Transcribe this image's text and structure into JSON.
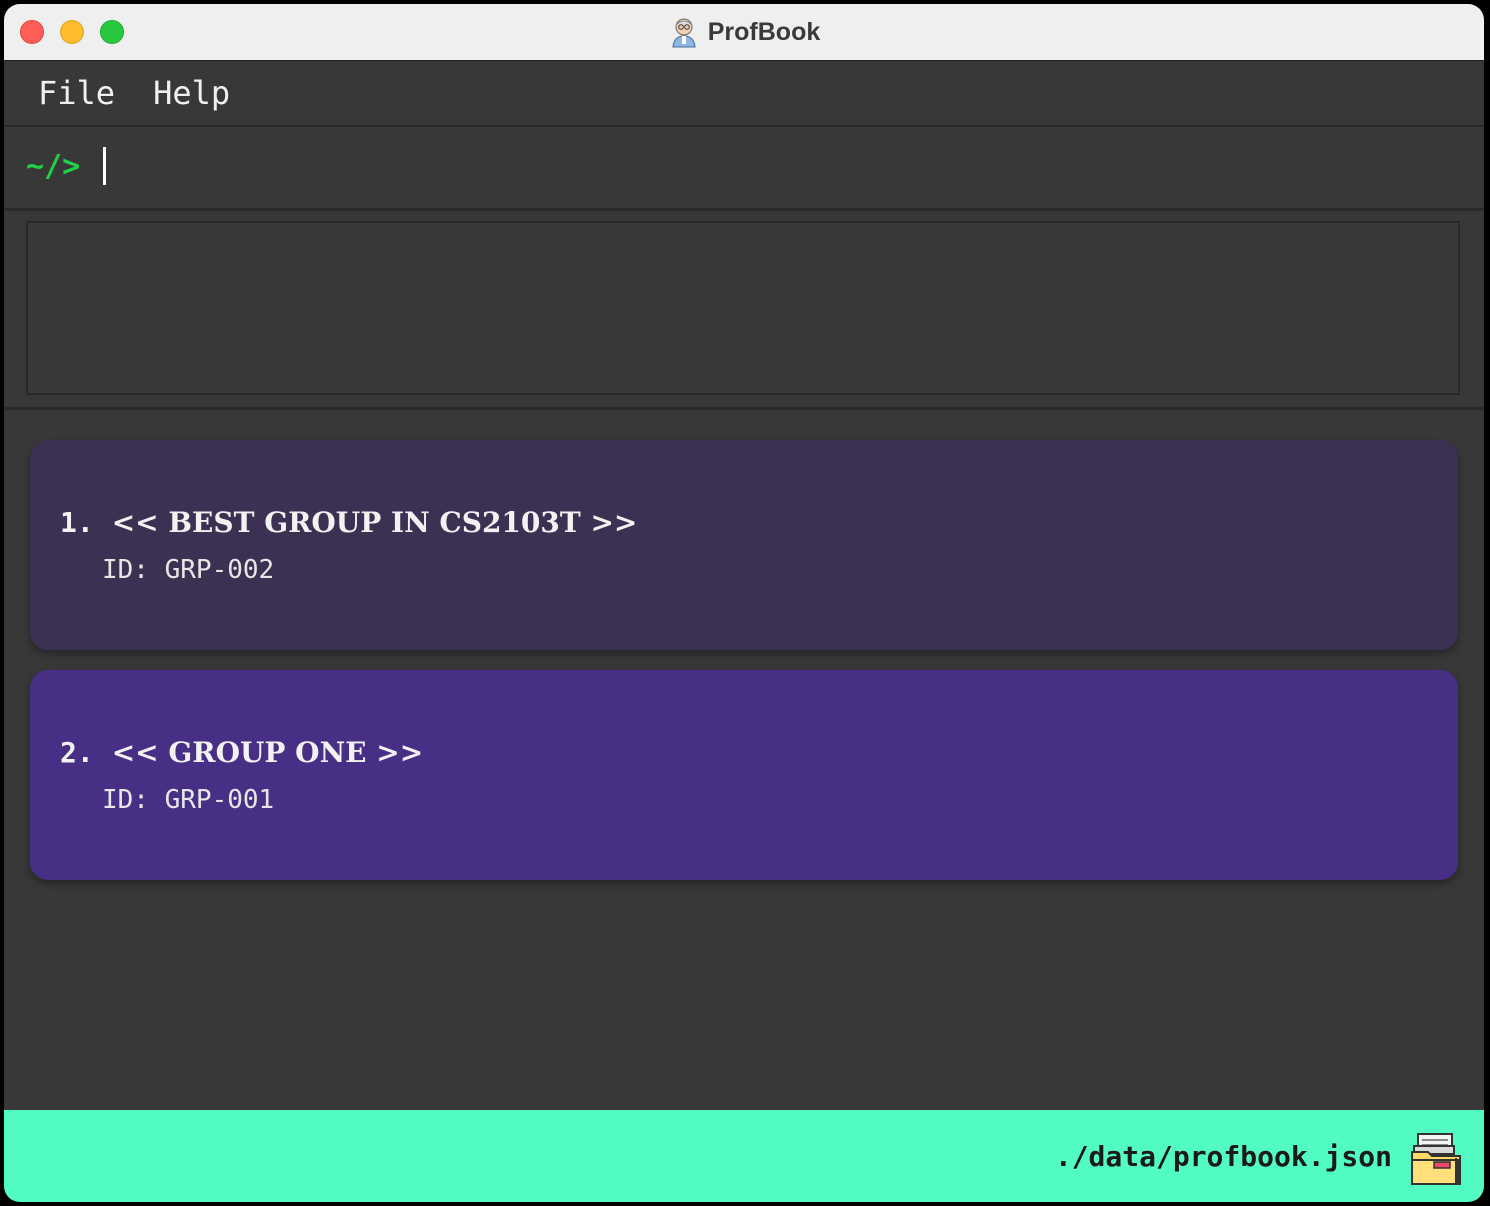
{
  "window": {
    "title": "ProfBook",
    "app_icon": "professor-avatar-icon"
  },
  "menu": {
    "items": [
      {
        "label": "File"
      },
      {
        "label": "Help"
      }
    ]
  },
  "command": {
    "prompt": "~/>",
    "value": "",
    "placeholder": ""
  },
  "result": {
    "text": ""
  },
  "groups": [
    {
      "index": "1.",
      "name": "<< BEST GROUP IN CS2103T >>",
      "id_label": "ID:",
      "id": "GRP-002",
      "color": "#3c3152"
    },
    {
      "index": "2.",
      "name": "<< GROUP ONE >>",
      "id_label": "ID:",
      "id": "GRP-001",
      "color": "#472f85"
    }
  ],
  "status": {
    "path": "./data/profbook.json",
    "icon": "folder-icon"
  },
  "colors": {
    "prompt": "#22d14a",
    "statusbar": "#52fbc4",
    "background": "#383838"
  }
}
